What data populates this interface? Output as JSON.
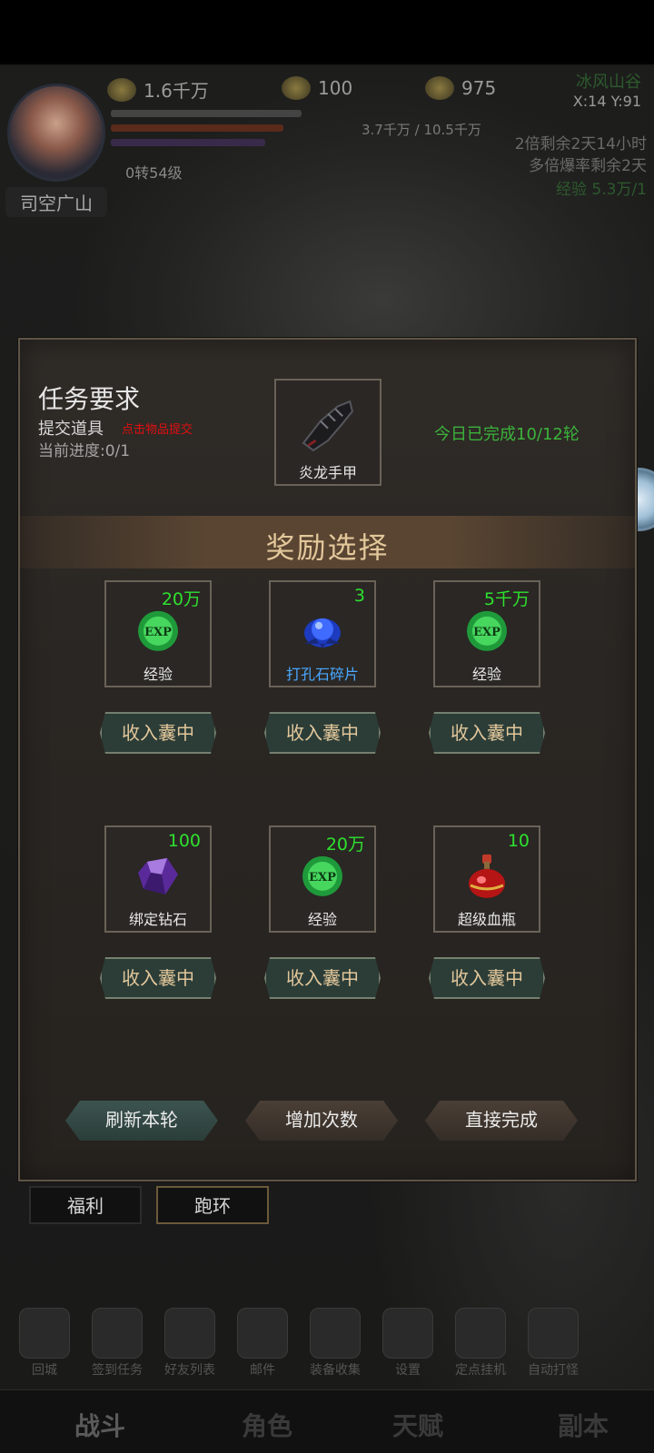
{
  "hud": {
    "gold": "1.6千万",
    "ingots": "100",
    "tickets": "975",
    "map_name": "冰风山谷",
    "coords": "X:14 Y:91",
    "player_name": "司空广山",
    "level": "0转54级",
    "exp": "3.7千万 / 10.5千万",
    "side_notes": [
      "2倍剩余2天14小时",
      "多倍爆率剩余2天",
      "经验 5.3万/1"
    ]
  },
  "panel": {
    "requirement_title": "任务要求",
    "submit_label": "提交道具",
    "submit_hint": "点击物品提交",
    "progress": "当前进度:0/1",
    "required_item": "炎龙手甲",
    "daily_status": "今日已完成10/12轮",
    "reward_title": "奖励选择",
    "rewards": [
      {
        "name": "经验",
        "count": "20万",
        "icon": "exp-orb-icon"
      },
      {
        "name": "打孔石碎片",
        "count": "3",
        "icon": "blue-gem-icon"
      },
      {
        "name": "经验",
        "count": "5千万",
        "icon": "exp-orb-icon"
      },
      {
        "name": "绑定钻石",
        "count": "100",
        "icon": "purple-diamond-icon"
      },
      {
        "name": "经验",
        "count": "20万",
        "icon": "exp-orb-icon"
      },
      {
        "name": "超级血瓶",
        "count": "10",
        "icon": "red-potion-icon"
      }
    ],
    "collect_label": "收入囊中",
    "actions": {
      "refresh": "刷新本轮",
      "add_times": "增加次数",
      "complete": "直接完成"
    }
  },
  "sub_tabs": [
    "福利",
    "跑环"
  ],
  "bottom_menu": [
    "回城",
    "签到任务",
    "好友列表",
    "邮件",
    "装备收集",
    "设置",
    "定点挂机",
    "自动打怪"
  ],
  "bottom_tabs": [
    "战斗",
    "角色",
    "天赋",
    "副本"
  ],
  "colors": {
    "accent_gold": "#e2c79a",
    "count_green": "#2fe02f",
    "status_green": "#3bb33b",
    "hint_red": "#e01010"
  }
}
